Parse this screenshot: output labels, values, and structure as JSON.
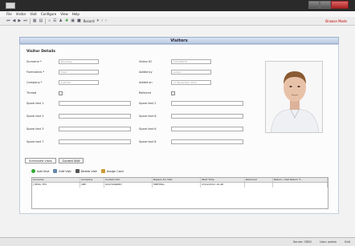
{
  "menu": [
    "File",
    "Visitor",
    "Visit",
    "Configure",
    "View",
    "Help"
  ],
  "toolbar": {
    "record_label": "Record",
    "browse_mode": "Browse Mode"
  },
  "panel_title": "Visitors",
  "section_title": "Visitor Details",
  "left_fields": [
    {
      "label": "Surname *",
      "value": "Blackaby"
    },
    {
      "label": "Forenames *",
      "value": "Elliot"
    },
    {
      "label": "Company *",
      "value": "Cabinet"
    },
    {
      "label": "Thread",
      "value": ""
    },
    {
      "label": "Spare text 1",
      "value": ""
    },
    {
      "label": "Spare text 2",
      "value": ""
    },
    {
      "label": "Spare text 3",
      "value": ""
    },
    {
      "label": "Spare text 7",
      "value": ""
    }
  ],
  "right_fields": [
    {
      "label": "Visitor ID",
      "value": "FV1000032"
    },
    {
      "label": "Added by",
      "value": "admin"
    },
    {
      "label": "Added on",
      "value": "17 November 2011"
    },
    {
      "label": "Referred",
      "value": ""
    },
    {
      "label": "Spare text 2",
      "value": ""
    },
    {
      "label": "Spare text 8",
      "value": ""
    },
    {
      "label": "Spare text 6",
      "value": ""
    },
    {
      "label": "Spare text 8",
      "value": ""
    }
  ],
  "tabs": [
    "Scheduled Visits",
    "Current Visit"
  ],
  "actions": {
    "add": "Add Visit",
    "edit": "Edit Visit",
    "delete": "Delete Visit",
    "assign": "Assign Card"
  },
  "grid": {
    "columns": [
      "Surname",
      "Company",
      "Contact Info",
      "Reason for Visit",
      "Start Time",
      "Returned",
      "Return / Visit Return T..."
    ],
    "row": [
      "J HESS, ETC",
      "CBH",
      "02071696887",
      "MEETING",
      "23/12/2011 10:48",
      "",
      ""
    ]
  },
  "status": {
    "server": "Server: CBSV",
    "user": "User: admin",
    "edit": "Edit"
  },
  "colors": {
    "browse_mode": "#cc0000",
    "header": "#bccbe2"
  }
}
